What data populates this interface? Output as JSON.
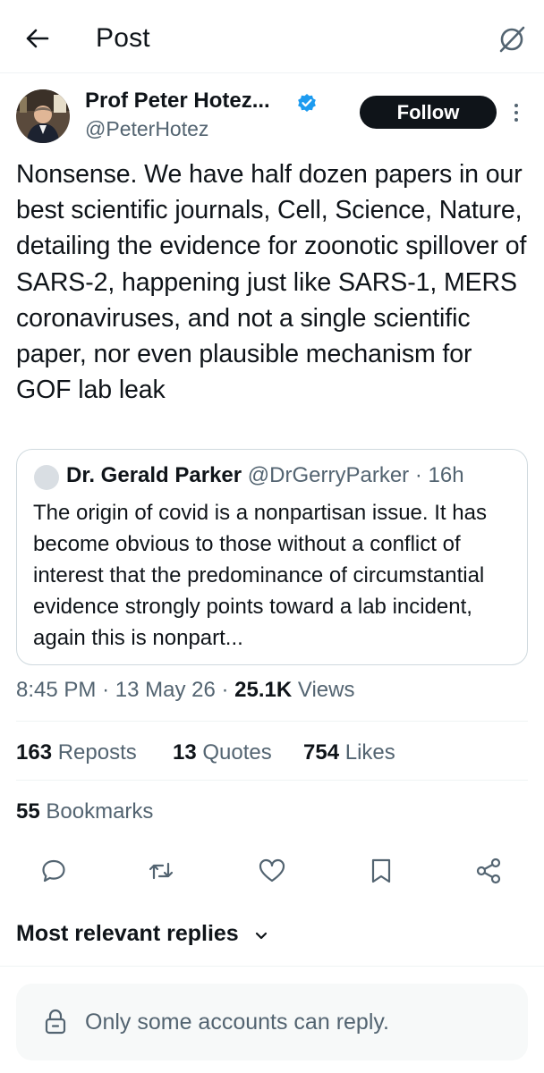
{
  "header": {
    "title": "Post",
    "back_icon": "arrow-left-icon",
    "grok_icon": "grok-icon"
  },
  "author": {
    "name": "Prof Peter Hotez...",
    "handle": "@PeterHotez",
    "verified": true,
    "follow_label": "Follow"
  },
  "post": {
    "text": "Nonsense. We have half dozen papers in our best scientific journals, Cell, Science, Nature, detailing the evidence for zoonotic spillover of SARS-2, happening just like SARS-1, MERS coronaviruses, and not a single scientific paper, nor even plausible mechanism for GOF lab leak"
  },
  "quote": {
    "name": "Dr. Gerald Parker",
    "handle": "@DrGerryParker",
    "separator": "·",
    "time": "16h",
    "text": "The origin of covid is a nonpartisan issue. It has become obvious to those without a conflict of interest that the predominance of circumstantial evidence strongly points toward a lab incident, again this is nonpart..."
  },
  "meta": {
    "time": "8:45 PM",
    "sep1": "·",
    "date": "13 May 26",
    "sep2": "·",
    "views_count": "25.1K",
    "views_label": "Views"
  },
  "stats": {
    "reposts_count": "163",
    "reposts_label": "Reposts",
    "quotes_count": "13",
    "quotes_label": "Quotes",
    "likes_count": "754",
    "likes_label": "Likes",
    "bookmarks_count": "55",
    "bookmarks_label": "Bookmarks"
  },
  "actions": [
    "reply-icon",
    "repost-icon",
    "like-icon",
    "bookmark-icon",
    "share-icon"
  ],
  "replies": {
    "sort_label": "Most relevant replies",
    "restriction_text": "Only some accounts can reply."
  },
  "colors": {
    "text": "#0f1419",
    "secondary": "#536471",
    "verified": "#1d9bf0",
    "border": "#cfd9de",
    "divider": "#eff3f4"
  }
}
